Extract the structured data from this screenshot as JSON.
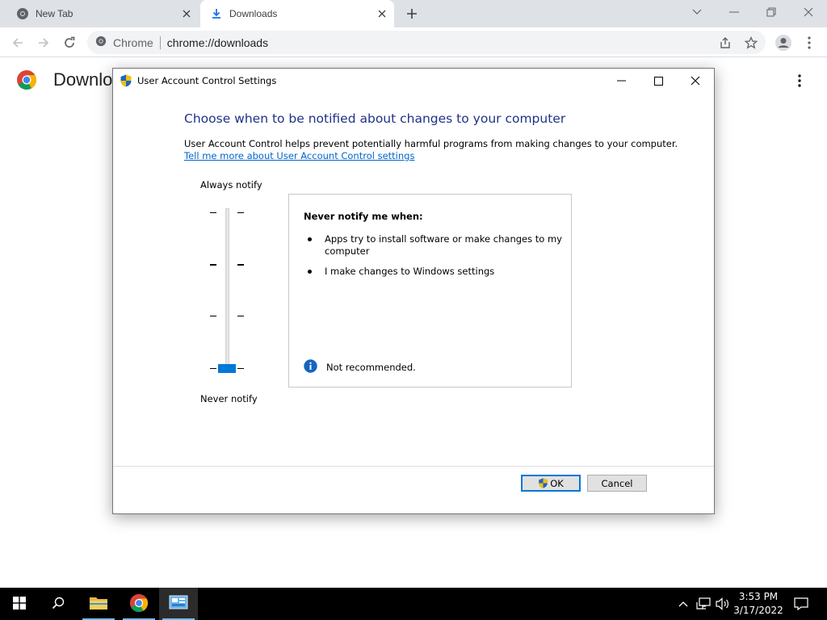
{
  "browser": {
    "tabs": [
      {
        "title": "New Tab",
        "icon": "chrome-icon"
      },
      {
        "title": "Downloads",
        "icon": "download-icon"
      }
    ],
    "omnibox": {
      "site_label": "Chrome",
      "url": "chrome://downloads"
    }
  },
  "page": {
    "title": "Downloads"
  },
  "dialog": {
    "title": "User Account Control Settings",
    "heading": "Choose when to be notified about changes to your computer",
    "description": "User Account Control helps prevent potentially harmful programs from making changes to your computer.",
    "link_text": "Tell me more about User Account Control settings",
    "slider": {
      "top_label": "Always notify",
      "bottom_label": "Never notify",
      "levels": 4,
      "selected_level": 1
    },
    "info": {
      "heading": "Never notify me when:",
      "items": [
        "Apps try to install software or make changes to my computer",
        "I make changes to Windows settings"
      ],
      "note": "Not recommended."
    },
    "buttons": {
      "ok": "OK",
      "cancel": "Cancel"
    }
  },
  "taskbar": {
    "time": "3:53 PM",
    "date": "3/17/2022"
  },
  "colors": {
    "accent": "#0078d7",
    "heading": "#1e3287",
    "link": "#0066cc"
  }
}
